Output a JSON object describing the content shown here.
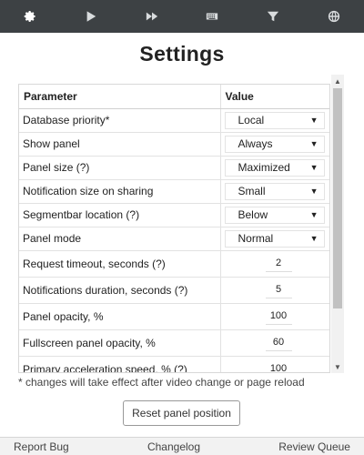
{
  "topbar": {
    "tabs": [
      {
        "icon": "gear-icon",
        "active": true
      },
      {
        "icon": "play-icon",
        "active": false
      },
      {
        "icon": "fast-forward-icon",
        "active": false
      },
      {
        "icon": "keyboard-icon",
        "active": false
      },
      {
        "icon": "filter-icon",
        "active": false
      },
      {
        "icon": "globe-icon",
        "active": false
      }
    ]
  },
  "title": "Settings",
  "table": {
    "headers": {
      "param": "Parameter",
      "value": "Value"
    },
    "rows": [
      {
        "label": "Database priority*",
        "value": "Local",
        "type": "select"
      },
      {
        "label": "Show panel",
        "value": "Always",
        "type": "select"
      },
      {
        "label": "Panel size (?)",
        "value": "Maximized",
        "type": "select"
      },
      {
        "label": "Notification size on sharing",
        "value": "Small",
        "type": "select"
      },
      {
        "label": "Segmentbar location (?)",
        "value": "Below",
        "type": "select"
      },
      {
        "label": "Panel mode",
        "value": "Normal",
        "type": "select"
      },
      {
        "label": "Request timeout, seconds (?)",
        "value": "2",
        "type": "number"
      },
      {
        "label": "Notifications duration, seconds (?)",
        "value": "5",
        "type": "number"
      },
      {
        "label": "Panel opacity, %",
        "value": "100",
        "type": "number"
      },
      {
        "label": "Fullscreen panel opacity, %",
        "value": "60",
        "type": "number"
      },
      {
        "label": "Primary acceleration speed, % (?)",
        "value": "100",
        "type": "number"
      }
    ]
  },
  "note": "* changes will take effect after video change or page reload",
  "reset_button": "Reset panel position",
  "footer": {
    "report_bug": "Report Bug",
    "changelog": "Changelog",
    "review_queue": "Review Queue"
  }
}
